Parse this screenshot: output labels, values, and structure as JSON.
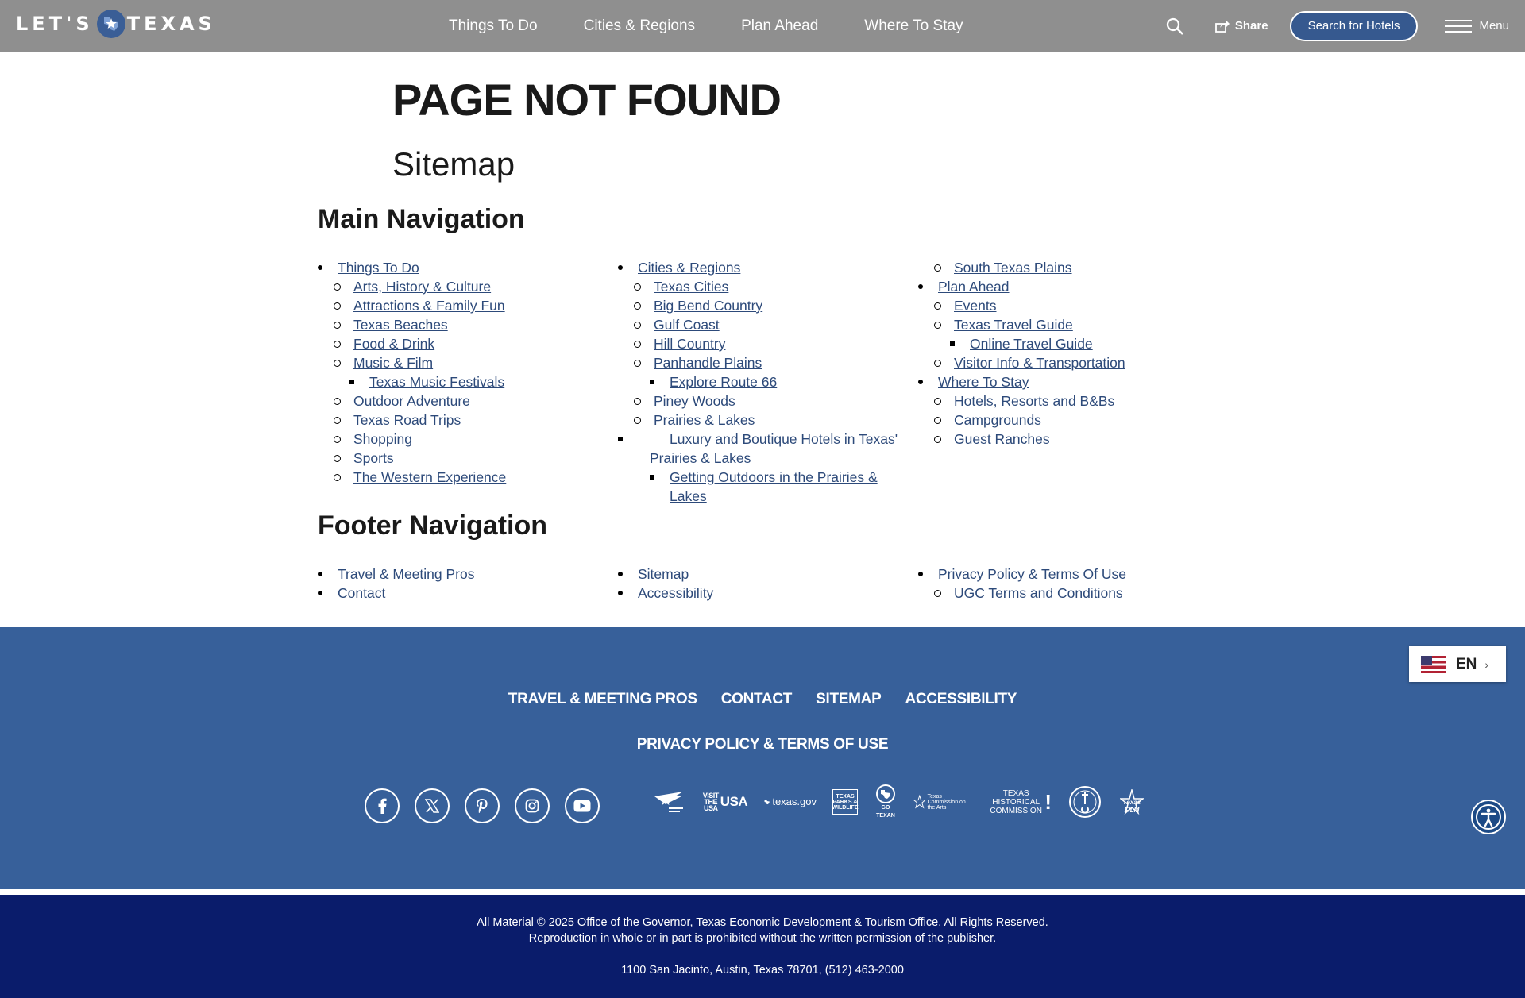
{
  "header": {
    "logo_left": "LET'S",
    "logo_right": "TEXAS",
    "nav": [
      "Things To Do",
      "Cities & Regions",
      "Plan Ahead",
      "Where To Stay"
    ],
    "share_label": "Share",
    "hotels_label": "Search for Hotels",
    "menu_label": "Menu"
  },
  "page": {
    "title": "PAGE NOT FOUND",
    "sitemap_title": "Sitemap",
    "main_nav_title": "Main Navigation",
    "footer_nav_title": "Footer Navigation"
  },
  "main_nav": {
    "col1": [
      {
        "label": "Things To Do",
        "level": 1
      },
      {
        "label": "Arts, History & Culture",
        "level": 2
      },
      {
        "label": "Attractions & Family Fun",
        "level": 2
      },
      {
        "label": "Texas Beaches",
        "level": 2
      },
      {
        "label": "Food & Drink",
        "level": 2
      },
      {
        "label": "Music & Film",
        "level": 2
      },
      {
        "label": "Texas Music Festivals",
        "level": 3
      },
      {
        "label": "Outdoor Adventure",
        "level": 2
      },
      {
        "label": "Texas Road Trips",
        "level": 2
      },
      {
        "label": "Shopping",
        "level": 2
      },
      {
        "label": "Sports",
        "level": 2
      },
      {
        "label": "The Western Experience",
        "level": 2
      }
    ],
    "col2": [
      {
        "label": "Cities & Regions",
        "level": 1
      },
      {
        "label": "Texas Cities",
        "level": 2
      },
      {
        "label": "Big Bend Country",
        "level": 2
      },
      {
        "label": "Gulf Coast",
        "level": 2
      },
      {
        "label": "Hill Country",
        "level": 2
      },
      {
        "label": "Panhandle Plains",
        "level": 2
      },
      {
        "label": "Explore Route 66",
        "level": 3
      },
      {
        "label": "Piney Woods",
        "level": 2
      },
      {
        "label": "Prairies & Lakes",
        "level": 2
      },
      {
        "label": "Luxury and Boutique Hotels in Texas' Prairies & Lakes",
        "level": 3
      },
      {
        "label": "Getting Outdoors in the Prairies & Lakes",
        "level": 3
      }
    ],
    "col3": [
      {
        "label": "South Texas Plains",
        "level": 2
      },
      {
        "label": "Plan Ahead",
        "level": 1
      },
      {
        "label": "Events",
        "level": 2
      },
      {
        "label": "Texas Travel Guide",
        "level": 2
      },
      {
        "label": "Online Travel Guide",
        "level": 3
      },
      {
        "label": "Visitor Info & Transportation",
        "level": 2
      },
      {
        "label": "Where To Stay",
        "level": 1
      },
      {
        "label": "Hotels, Resorts and B&Bs",
        "level": 2
      },
      {
        "label": "Campgrounds",
        "level": 2
      },
      {
        "label": "Guest Ranches",
        "level": 2
      }
    ]
  },
  "footer_nav": {
    "col1": [
      {
        "label": "Travel & Meeting Pros",
        "level": 1
      },
      {
        "label": "Contact",
        "level": 1
      }
    ],
    "col2": [
      {
        "label": "Sitemap",
        "level": 1
      },
      {
        "label": "Accessibility",
        "level": 1
      }
    ],
    "col3": [
      {
        "label": "Privacy Policy & Terms Of Use",
        "level": 1
      },
      {
        "label": "UGC Terms and Conditions",
        "level": 2
      }
    ]
  },
  "footer": {
    "links_row1": [
      "TRAVEL & MEETING PROS",
      "CONTACT",
      "SITEMAP",
      "ACCESSIBILITY"
    ],
    "links_row2": [
      "PRIVACY POLICY & TERMS OF USE"
    ],
    "social_icons": [
      "facebook-icon",
      "x-icon",
      "pinterest-icon",
      "instagram-icon",
      "youtube-icon"
    ],
    "partners": {
      "visit_usa": "VISIT THE USA",
      "texas_gov": "texas.gov",
      "tpwd": "TEXAS PARKS & WILDLIFE",
      "go_texan": "GO TEXAN",
      "arts": "Texas Commission on the Arts",
      "historical": "TEXAS HISTORICAL COMMISSION",
      "film": "Texas FILM"
    },
    "language": "EN",
    "copyright": "All Material © 2025 Office of the Governor, Texas Economic Development & Tourism Office. All Rights Reserved.",
    "reproduction": "Reproduction in whole or in part is prohibited without the written permission of the publisher.",
    "address": "1100 San Jacinto, Austin, Texas 78701, (512) 463-2000"
  },
  "colors": {
    "header_bg": "#8f8f8f",
    "link": "#2d4a7a",
    "footer_bg": "#37609a",
    "bottom_bg": "#0a1c6b",
    "button_bg": "#36598f"
  }
}
